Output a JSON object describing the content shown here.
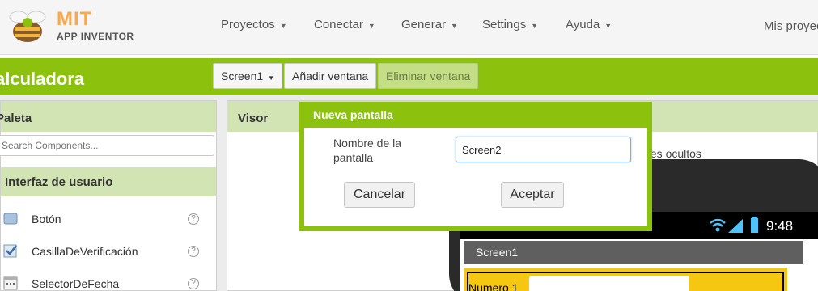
{
  "brand": {
    "name": "MIT",
    "product": "APP INVENTOR"
  },
  "nav": {
    "items": [
      {
        "label": "Proyectos"
      },
      {
        "label": "Conectar"
      },
      {
        "label": "Generar"
      },
      {
        "label": "Settings"
      },
      {
        "label": "Ayuda"
      }
    ],
    "right_label": "Mis proyec"
  },
  "project": {
    "title": "alculadora",
    "screen_select": "Screen1",
    "add_screen": "Añadir ventana",
    "remove_screen": "Eliminar ventana"
  },
  "palette": {
    "header": "Paleta",
    "search_placeholder": "Search Components...",
    "category": "Interfaz de usuario",
    "components": [
      {
        "label": "Botón",
        "icon": "button-icon"
      },
      {
        "label": "CasillaDeVerificación",
        "icon": "checkbox-icon"
      },
      {
        "label": "SelectorDeFecha",
        "icon": "calendar-icon"
      }
    ],
    "help_glyph": "?"
  },
  "viewer": {
    "header": "Visor",
    "hidden_note": "tes ocultos",
    "phone": {
      "time": "9:48",
      "screen_title": "Screen1",
      "field_label": "Numero 1"
    }
  },
  "dialog": {
    "title": "Nueva pantalla",
    "field_label": "Nombre de la pantalla",
    "field_value": "Screen2",
    "cancel": "Cancelar",
    "accept": "Aceptar"
  },
  "colors": {
    "accent": "#8cc20e",
    "panel_header": "#d2e4b3",
    "logo_orange": "#f9a94a",
    "phone_form": "#f5c710"
  }
}
